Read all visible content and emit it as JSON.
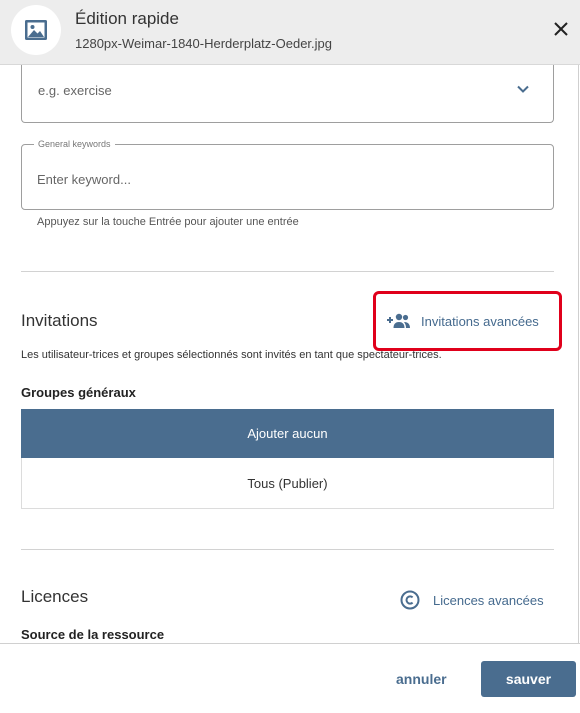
{
  "header": {
    "title": "Édition rapide",
    "filename": "1280px-Weimar-1840-Herderplatz-Oeder.jpg",
    "icon": "image-icon",
    "close_icon": "close-icon"
  },
  "form": {
    "select_value": "e.g. exercise",
    "keywords": {
      "legend": "General keywords",
      "placeholder": "Enter keyword...",
      "hint": "Appuyez sur la touche Entrée pour ajouter une entrée"
    }
  },
  "invitations": {
    "title": "Invitations",
    "advanced_link": "Invitations avancées",
    "advanced_icon": "group-add-icon",
    "description": "Les utilisateur-trices et groupes sélectionnés sont invités en tant que spectateur-trices.",
    "groups_title": "Groupes généraux",
    "groups": [
      {
        "label": "Ajouter aucun",
        "selected": true
      },
      {
        "label": "Tous (Publier)",
        "selected": false
      }
    ]
  },
  "licenses": {
    "title": "Licences",
    "advanced_link": "Licences avancées",
    "advanced_icon": "copyright-icon",
    "source_title": "Source de la ressource"
  },
  "footer": {
    "cancel_label": "annuler",
    "save_label": "sauver"
  },
  "colors": {
    "accent": "#4a6d8f",
    "highlight": "#e0001b",
    "header_bg": "#ededed"
  }
}
